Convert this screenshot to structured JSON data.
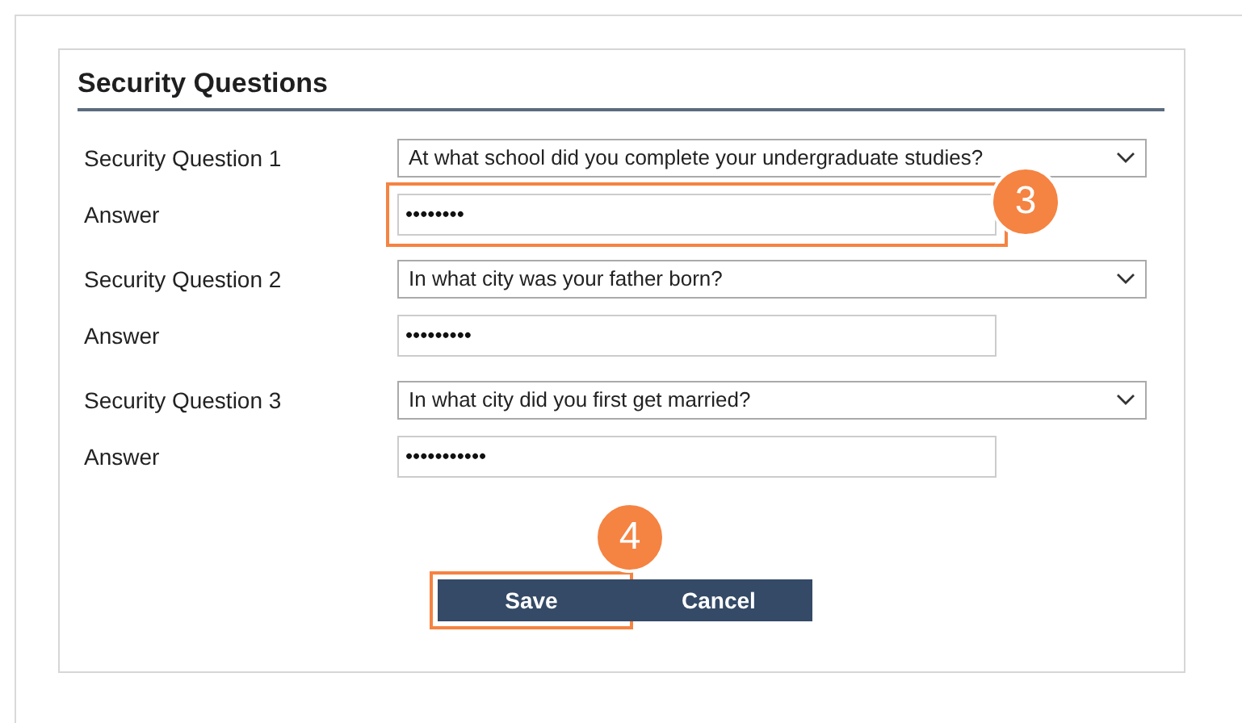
{
  "title": "Security Questions",
  "questions": [
    {
      "label": "Security Question 1",
      "question": "At what school did you complete your undergraduate studies?",
      "answer_label": "Answer",
      "answer": "••••••••",
      "highlighted": true,
      "callout": "3"
    },
    {
      "label": "Security Question 2",
      "question": "In what city was your father born?",
      "answer_label": "Answer",
      "answer": "•••••••••",
      "highlighted": false
    },
    {
      "label": "Security Question 3",
      "question": "In what city did you first get married?",
      "answer_label": "Answer",
      "answer": "•••••••••••",
      "highlighted": false
    }
  ],
  "buttons": [
    {
      "label": "Save",
      "highlighted": true,
      "callout": "4"
    },
    {
      "label": "Cancel",
      "highlighted": false
    }
  ]
}
